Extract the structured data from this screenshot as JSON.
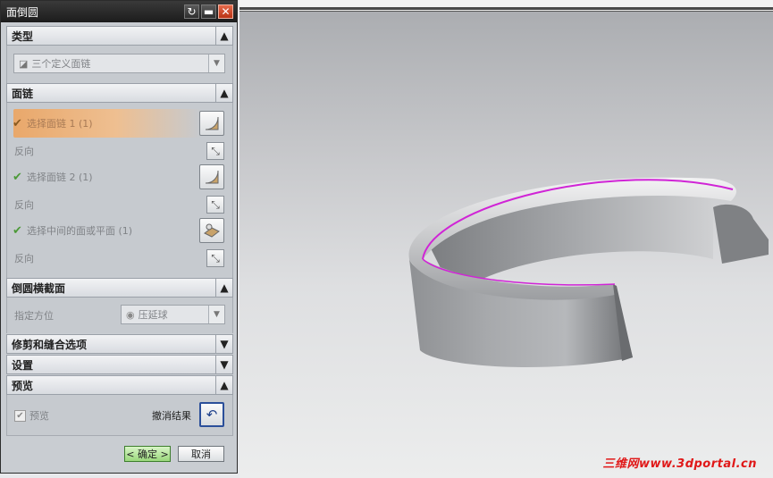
{
  "dialog": {
    "title": "面倒圆",
    "sections": {
      "type": {
        "label": "类型",
        "selected": "三个定义面链"
      },
      "face_chain": {
        "label": "面链",
        "select1": "选择面链 1 (1)",
        "reverse1": "反向",
        "select2": "选择面链 2 (1)",
        "reverse2": "反向",
        "select_mid": "选择中间的面或平面 (1)",
        "reverse3": "反向"
      },
      "cross_section": {
        "label": "倒圆横截面",
        "orientation_label": "指定方位",
        "orientation_value": "压延球"
      },
      "trim": {
        "label": "修剪和缝合选项"
      },
      "settings": {
        "label": "设置"
      },
      "preview": {
        "label": "预览",
        "preview_checkbox": "预览",
        "undo_result": "撤消结果"
      }
    },
    "buttons": {
      "ok": "< 确定 >",
      "cancel": "取消"
    }
  },
  "watermark": "三维网www.3dportal.cn"
}
